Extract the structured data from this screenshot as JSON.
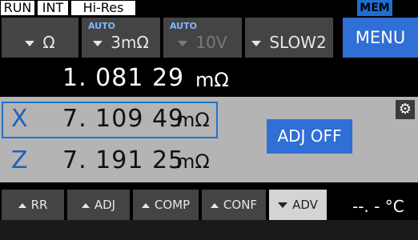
{
  "status": {
    "run": "RUN",
    "int": "INT",
    "mode": "Hi-Res",
    "mem": "MEM"
  },
  "toolbar": {
    "function_label": "Ω",
    "range": {
      "auto": "AUTO",
      "label": "3mΩ"
    },
    "voltage": {
      "auto": "AUTO",
      "label": "10V"
    },
    "speed_label": "SLOW2",
    "menu_label": "MENU"
  },
  "readings": {
    "r": {
      "value": "1. 081 29",
      "unit": "mΩ"
    },
    "x": {
      "letter": "X",
      "value": "7. 109 49",
      "unit": "mΩ"
    },
    "z": {
      "letter": "Z",
      "value": "7. 191 25",
      "unit": "mΩ"
    }
  },
  "panel": {
    "adj_label": "ADJ OFF",
    "settings_icon": "gear-icon"
  },
  "tabs": [
    {
      "label": "RR",
      "arrow": "up"
    },
    {
      "label": "ADJ",
      "arrow": "up"
    },
    {
      "label": "COMP",
      "arrow": "up"
    },
    {
      "label": "CONF",
      "arrow": "up"
    },
    {
      "label": "ADV",
      "arrow": "down"
    }
  ],
  "temperature": "--. - °C",
  "colors": {
    "accent": "#2f6fd6",
    "panel": "#b4b4b4",
    "button": "#444444",
    "letter": "#1e5fbf"
  }
}
